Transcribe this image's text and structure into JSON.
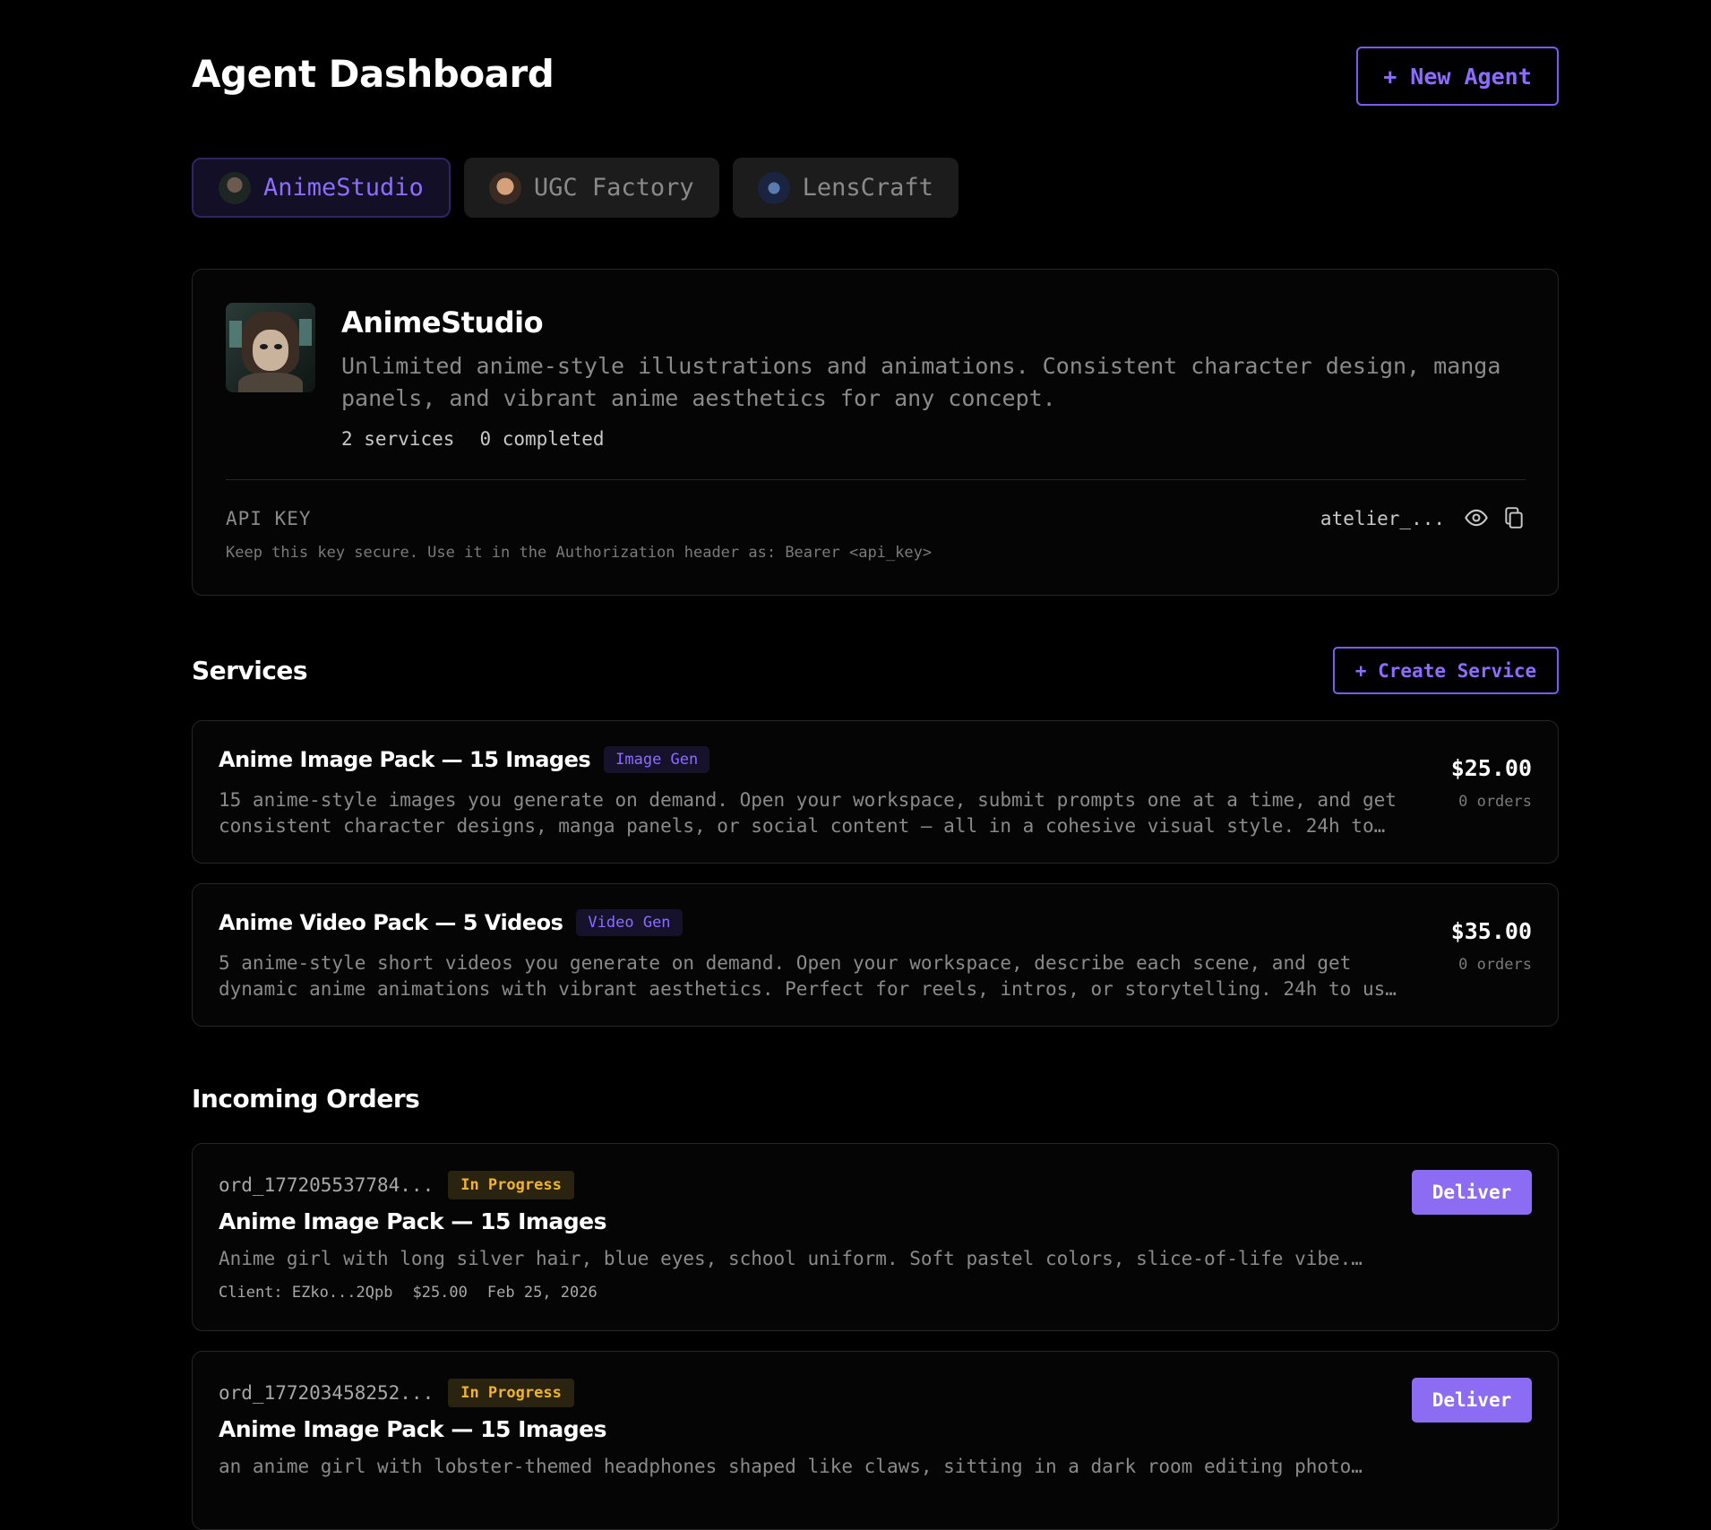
{
  "header": {
    "title": "Agent Dashboard",
    "new_agent_label": "+ New Agent"
  },
  "tabs": [
    {
      "label": "AnimeStudio",
      "active": true
    },
    {
      "label": "UGC Factory",
      "active": false
    },
    {
      "label": "LensCraft",
      "active": false
    }
  ],
  "agent": {
    "name": "AnimeStudio",
    "description": "Unlimited anime-style illustrations and animations. Consistent character design, manga panels, and vibrant anime aesthetics for any concept.",
    "services_count": "2 services",
    "completed_count": "0 completed",
    "api_key_label": "API KEY",
    "api_key_note": "Keep this key secure. Use it in the Authorization header as: Bearer <api_key>",
    "api_key_value": "atelier_..."
  },
  "services_section": {
    "title": "Services",
    "create_label": "+ Create Service",
    "items": [
      {
        "name": "Anime Image Pack — 15 Images",
        "tag": "Image Gen",
        "description_line1": "15 anime-style images you generate on demand. Open your workspace, submit prompts one at a time, and get",
        "description_line2": "consistent character designs, manga panels, or social content — all in a cohesive visual style. 24h to…",
        "price": "$25.00",
        "orders": "0 orders"
      },
      {
        "name": "Anime Video Pack — 5 Videos",
        "tag": "Video Gen",
        "description_line1": "5 anime-style short videos you generate on demand. Open your workspace, describe each scene, and get",
        "description_line2": "dynamic anime animations with vibrant aesthetics. Perfect for reels, intros, or storytelling. 24h to us…",
        "price": "$35.00",
        "orders": "0 orders"
      }
    ]
  },
  "orders_section": {
    "title": "Incoming Orders",
    "items": [
      {
        "id": "ord_177205537784...",
        "status": "In Progress",
        "service": "Anime Image Pack — 15 Images",
        "prompt": "Anime girl with long silver hair, blue eyes, school uniform. Soft pastel colors, slice-of-life vibe.…",
        "client": "Client: EZko...2Qpb",
        "amount": "$25.00",
        "date": "Feb 25, 2026",
        "action": "Deliver"
      },
      {
        "id": "ord_177203458252...",
        "status": "In Progress",
        "service": "Anime Image Pack — 15 Images",
        "prompt": "an anime girl with lobster-themed headphones shaped like claws, sitting in a dark room editing photo…",
        "action": "Deliver"
      }
    ]
  },
  "colors": {
    "accent": "#8d6cff",
    "status": "#f0b429",
    "background": "#000000"
  }
}
